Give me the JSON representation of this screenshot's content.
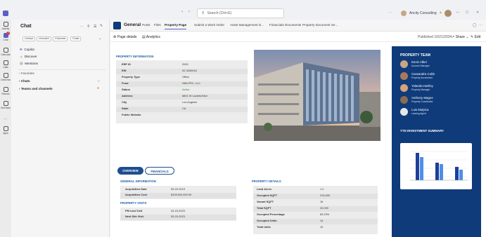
{
  "titlebar": {
    "search_placeholder": "Search (Ctrl+E)",
    "org_name": "Ancity Consulting"
  },
  "rail": {
    "items": [
      {
        "label": "Activity",
        "icon": "bell-icon"
      },
      {
        "label": "Chat",
        "icon": "chat-icon",
        "badge": "2"
      },
      {
        "label": "Calendar",
        "icon": "calendar-icon"
      },
      {
        "label": "Calls",
        "icon": "phone-icon"
      },
      {
        "label": "OneDrive",
        "icon": "cloud-icon"
      },
      {
        "label": "Planner",
        "icon": "planner-icon"
      },
      {
        "label": "OrbiTeam",
        "icon": "teams-icon"
      },
      {
        "label": "...",
        "icon": "more-icon"
      },
      {
        "label": "Apps",
        "icon": "apps-icon"
      }
    ]
  },
  "chat": {
    "title": "Chat",
    "filters": [
      "Unread",
      "Unmuted",
      "Channels",
      "Chats"
    ],
    "quick": [
      {
        "label": "Copilot",
        "icon": "copilot-icon"
      },
      {
        "label": "Discover",
        "icon": "discover-icon"
      },
      {
        "label": "Mentions",
        "icon": "at-icon"
      }
    ],
    "sections": [
      {
        "label": "Favorites"
      },
      {
        "label": "Chats"
      },
      {
        "label": "Teams and channels"
      }
    ]
  },
  "channel": {
    "name": "General",
    "tabs": [
      "Posts",
      "Files",
      "Property Page",
      "Submit a Work Order",
      "Asset Management D...",
      "Financials Documents",
      "Property Document Se..."
    ]
  },
  "pagebar": {
    "page_details": "Page details",
    "analytics": "Analytics",
    "published": "Published 10/21/2024",
    "share": "Share",
    "edit": "Edit"
  },
  "property_info": {
    "heading": "PROPERTY INFORMATION",
    "rows": [
      {
        "k": "ERP ID",
        "v": "2000"
      },
      {
        "k": "EIN",
        "v": "02-3340044"
      },
      {
        "k": "Property Type",
        "v": "Office"
      },
      {
        "k": "Fund",
        "v": "NWLFRC, LLC"
      },
      {
        "k": "Status",
        "v": "Active"
      },
      {
        "k": "Address",
        "v": "8801 W Lacleta Blvd"
      },
      {
        "k": "City",
        "v": "Los Angeles"
      },
      {
        "k": "State",
        "v": "CA"
      },
      {
        "k": "Public Website",
        "v": ""
      }
    ]
  },
  "tabs2": {
    "overview": "OVERVIEW",
    "financials": "FINANCIALS"
  },
  "general_info": {
    "heading": "GENERAL INFORMATION",
    "rows": [
      {
        "k": "Acquisition Date",
        "v": "05-20-2019"
      },
      {
        "k": "Acquisition Cost",
        "v": "$128,000,000.00"
      }
    ]
  },
  "visits": {
    "heading": "PROPERTY VISITS",
    "rows": [
      {
        "k": "PM Last Visit",
        "v": "04-15-2023"
      },
      {
        "k": "Next Site Visit",
        "v": "05-20-2023"
      }
    ]
  },
  "details": {
    "heading": "PROPERTY DETAILS",
    "rows": [
      {
        "k": "Land Acres",
        "v": "1.2"
      },
      {
        "k": "Occupied SQFT",
        "v": "215,000"
      },
      {
        "k": "Vacant SQFT",
        "v": "16"
      },
      {
        "k": "Total SQFT",
        "v": "32,000"
      },
      {
        "k": "Occupied Percentage",
        "v": "83.23%"
      },
      {
        "k": "Occupied Units",
        "v": "14"
      },
      {
        "k": "Total Units",
        "v": "15"
      }
    ]
  },
  "team": {
    "heading": "PROPERTY TEAM",
    "members": [
      {
        "name": "Kevin Albel",
        "role": "Account Manager"
      },
      {
        "name": "Cassandra Cobb",
        "role": "Property Accountant"
      },
      {
        "name": "Yolanda Harfiey",
        "role": "Property Manager"
      },
      {
        "name": "Anthony Magee",
        "role": "Property Coordinator"
      },
      {
        "name": "Luis Mulpica",
        "role": "Leasing Agent"
      }
    ]
  },
  "ytd": {
    "heading": "YTD INVESTMENT SUMMARY"
  },
  "colors": {
    "accent": "#1d5fa8",
    "teams_purple": "#5b5fc7",
    "team_panel": "#0f3b7a"
  }
}
